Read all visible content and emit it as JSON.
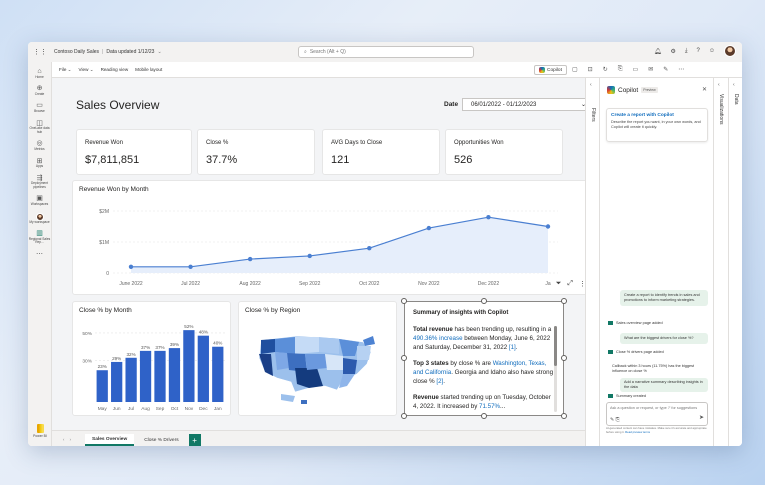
{
  "titlebar": {
    "report_name": "Contoso Daily Sales",
    "updated": "Data updated 1/12/23",
    "search_placeholder": "Search (Alt + Q)"
  },
  "rail": {
    "items": [
      {
        "label": "Home",
        "icon": "home-icon"
      },
      {
        "label": "Create",
        "icon": "create-icon"
      },
      {
        "label": "Browse",
        "icon": "browse-icon"
      },
      {
        "label": "OneLake data hub",
        "icon": "datahub-icon"
      },
      {
        "label": "Metrics",
        "icon": "metrics-icon"
      },
      {
        "label": "Apps",
        "icon": "apps-icon"
      },
      {
        "label": "Deployment pipelines",
        "icon": "pipeline-icon"
      },
      {
        "label": "Workspaces",
        "icon": "workspaces-icon"
      },
      {
        "label": "My workspace",
        "icon": "avatar"
      },
      {
        "label": "Regional Sales Rep...",
        "icon": "report-icon"
      }
    ],
    "bottom_label": "Power BI"
  },
  "ribbon": {
    "menu": [
      "File",
      "View",
      "Reading view",
      "Mobile layout"
    ],
    "copilot_label": "Copilot"
  },
  "report": {
    "title": "Sales Overview",
    "date_label": "Date",
    "date_range": "06/01/2022 - 01/12/2023",
    "kpis": [
      {
        "label": "Revenue Won",
        "value": "$7,811,851"
      },
      {
        "label": "Close %",
        "value": "37.7%"
      },
      {
        "label": "AVG Days to Close",
        "value": "121"
      },
      {
        "label": "Opportunities Won",
        "value": "526"
      }
    ],
    "revenue_title": "Revenue Won by Month",
    "close_month_title": "Close % by Month",
    "region_title": "Close % by Region",
    "insights": {
      "title": "Summary of insights with Copilot",
      "p1_bold": "Total revenue",
      "p1_a": " has been trending up, resulting in a ",
      "p1_hl": "490.36% increase",
      "p1_b": " between Monday, June 6, 2022 and Saturday, December 31, 2022 ",
      "p1_ref": "[1]",
      "p1_end": ".",
      "p2_bold": "Top 3 states",
      "p2_a": " by close % are ",
      "p2_hl": "Washington, Texas, and California",
      "p2_b": ". Georgia and Idaho also have strong close % ",
      "p2_ref": "[2]",
      "p2_end": ".",
      "p3_bold": "Revenue",
      "p3_a": " started trending up on Tuesday, October 4, 2022. It increased by ",
      "p3_hl": "71.57%",
      "p3_end": "..."
    }
  },
  "chart_data": [
    {
      "type": "line",
      "title": "Revenue Won by Month",
      "x": [
        "Jun 2022",
        "Jul 2022",
        "Aug 2022",
        "Sep 2022",
        "Oct 2022",
        "Nov 2022",
        "Dec 2022",
        "Jan 2023"
      ],
      "tick_labels": [
        "June 2022",
        "Jul 2022",
        "Aug 2022",
        "Sep 2022",
        "Oct 2022",
        "Nov 2022",
        "Dec 2022",
        "Ja"
      ],
      "values": [
        0.2,
        0.2,
        0.45,
        0.55,
        0.8,
        1.45,
        1.8,
        1.5
      ],
      "ylim": [
        0,
        2
      ],
      "y_ticks": [
        {
          "v": 0,
          "label": "0"
        },
        {
          "v": 1,
          "label": "$1M"
        },
        {
          "v": 2,
          "label": "$2M"
        }
      ],
      "color": "#4a7fd1",
      "area": true
    },
    {
      "type": "bar",
      "title": "Close % by Month",
      "categories": [
        "May",
        "Jun",
        "Jul",
        "Aug",
        "Sep",
        "Oct",
        "Nov",
        "Dec",
        "Jan"
      ],
      "values": [
        23,
        29,
        32,
        37,
        37,
        39,
        52,
        48,
        40
      ],
      "data_labels": [
        "23%",
        "29%",
        "32%",
        "37%",
        "37%",
        "39%",
        "52%",
        "48%",
        "40%"
      ],
      "ylim": [
        0,
        55
      ],
      "y_ticks": [
        {
          "v": 30,
          "label": "30%"
        },
        {
          "v": 50,
          "label": "50%"
        }
      ],
      "color": "#2f62c8"
    }
  ],
  "tabs": [
    "Sales Overview",
    "Close % Drivers"
  ],
  "strips": {
    "filters": "Filters",
    "visualizations": "Visualizations",
    "data": "Data"
  },
  "copilot": {
    "title": "Copilot",
    "badge": "Preview",
    "card_title": "Create a report with Copilot",
    "card_desc": "Describe the report you want, in your own words, and Copilot will create it quickly.",
    "msg1": "Create a report to identify trends in sales and promotions to inform marketing strategies.",
    "status1": "Sales overview page added",
    "msg2": "What are the biggest drivers for close %?",
    "status2": "Close % drivers page added",
    "msg3": "Callback within 3 hours (11.75%) has the biggest influence on close %",
    "msg4": "Add a narrative summary describing insights in the data",
    "status3": "Summary created",
    "input_placeholder": "Ask a question or request, or type '/' for suggestions",
    "foot": "AI-generated content can have mistakes. Make sure it's accurate and appropriate before using it.",
    "foot_link": "Read preview terms"
  }
}
